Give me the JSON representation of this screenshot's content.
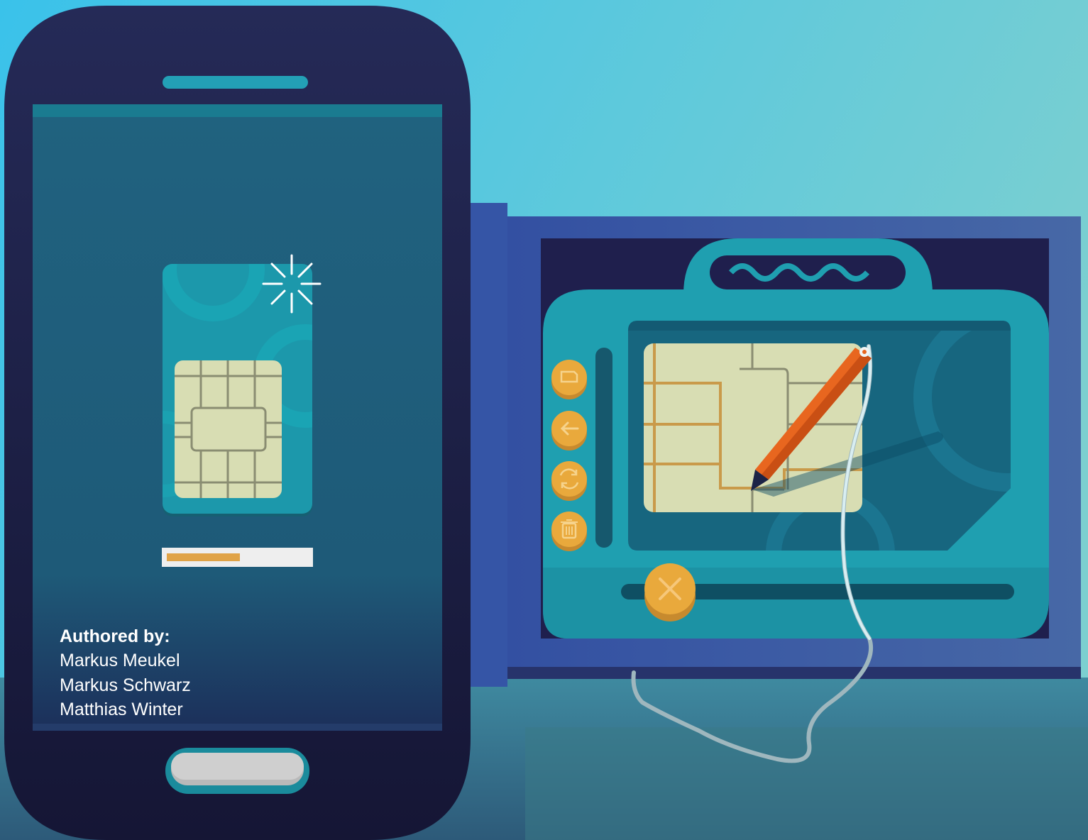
{
  "credits": {
    "heading": "Authored by:",
    "authors": [
      "Markus Meukel",
      "Markus Schwarz",
      "Matthias Winter"
    ]
  },
  "progress": {
    "fraction": 0.5
  },
  "icons": {
    "sparkle": "sparkle-icon",
    "sim_card": "sim-card-icon",
    "side_buttons": [
      "sim-icon",
      "arrow-left-icon",
      "refresh-icon",
      "trash-icon"
    ],
    "close": "close-icon",
    "pencil": "pencil-icon"
  },
  "colors": {
    "sky_top": "#3fc3e8",
    "phone_body": "#232651",
    "phone_screen": "#1f6281",
    "sim_card": "#1c98ab",
    "chip": "#d8ddb3",
    "chip_lines": "#c99a4a",
    "progress_fill": "#e0a347",
    "button_orange": "#e9a93c",
    "tablet_teal": "#1f9fb0",
    "pencil_orange": "#e8661f"
  }
}
